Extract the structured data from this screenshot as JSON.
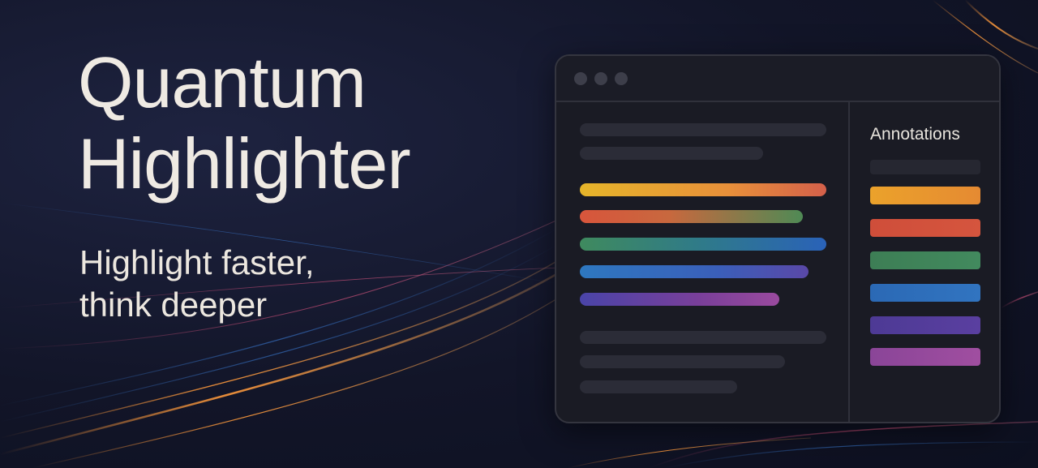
{
  "hero": {
    "title_line1": "Quantum",
    "title_line2": "Highlighter",
    "subtitle_line1": "Highlight faster,",
    "subtitle_line2": "think deeper"
  },
  "sidebar": {
    "title": "Annotations"
  },
  "colors": {
    "yellow": "#e8b52c",
    "orange": "#e08a33",
    "red": "#d5533f",
    "green": "#3f8a5e",
    "blue": "#2f6fbf",
    "purple": "#5a3fa0",
    "magenta": "#9a4aa0",
    "placeholder": "#2b2c37"
  }
}
